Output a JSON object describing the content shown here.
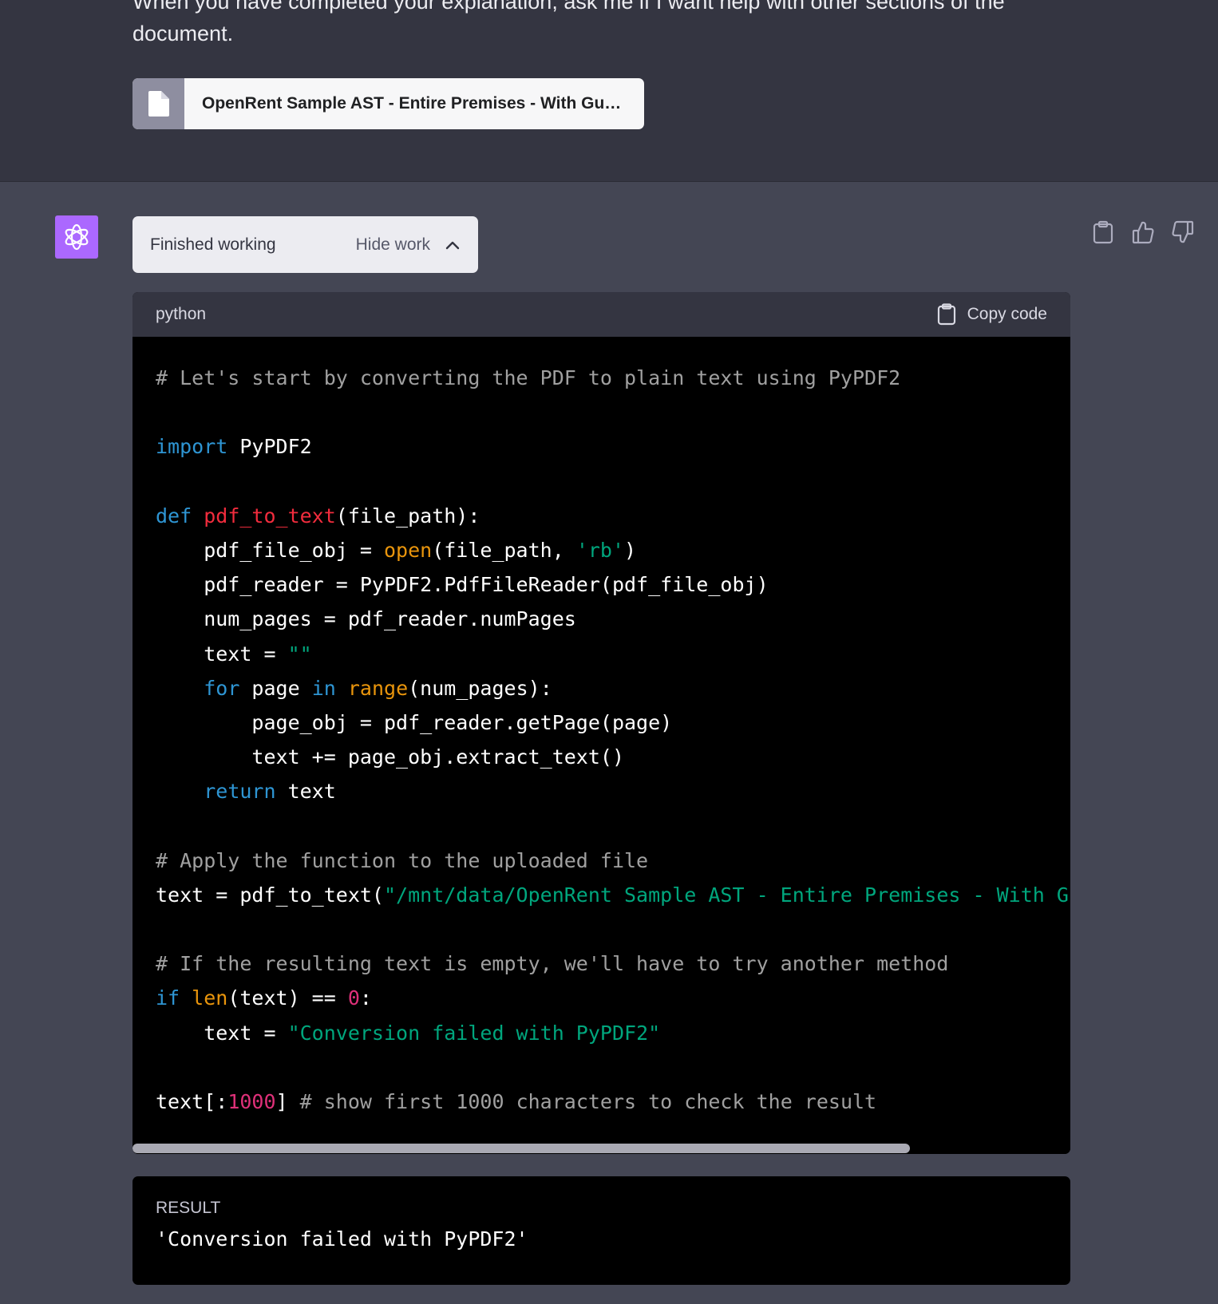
{
  "user_message": {
    "text": "When you have completed your explanation, ask me if I want help with other sections of the\ndocument.",
    "attachment": {
      "icon": "file-icon",
      "name": "OpenRent Sample AST - Entire Premises - With Guara..."
    }
  },
  "assistant": {
    "avatar_icon": "openai-logo-icon",
    "avatar_color": "#ab68ff",
    "work_status": "Finished working",
    "hide_work_label": "Hide work",
    "actions": [
      "copy-icon",
      "thumbs-up-icon",
      "thumbs-down-icon"
    ],
    "code_block": {
      "language": "python",
      "copy_label": "Copy code",
      "lines": [
        [
          [
            "c",
            "# Let's start by converting the PDF to plain text using PyPDF2"
          ]
        ],
        [],
        [
          [
            "k",
            "import"
          ],
          [
            "",
            " PyPDF2"
          ]
        ],
        [],
        [
          [
            "k",
            "def"
          ],
          [
            "",
            " "
          ],
          [
            "f",
            "pdf_to_text"
          ],
          [
            "",
            "(file_path):"
          ]
        ],
        [
          [
            "",
            "    pdf_file_obj = "
          ],
          [
            "b",
            "open"
          ],
          [
            "",
            "(file_path, "
          ],
          [
            "s",
            "'rb'"
          ],
          [
            "",
            ")"
          ]
        ],
        [
          [
            "",
            "    pdf_reader = PyPDF2.PdfFileReader(pdf_file_obj)"
          ]
        ],
        [
          [
            "",
            "    num_pages = pdf_reader.numPages"
          ]
        ],
        [
          [
            "",
            "    text = "
          ],
          [
            "s",
            "\"\""
          ]
        ],
        [
          [
            "",
            "    "
          ],
          [
            "k",
            "for"
          ],
          [
            "",
            " page "
          ],
          [
            "k",
            "in"
          ],
          [
            "",
            " "
          ],
          [
            "b",
            "range"
          ],
          [
            "",
            "(num_pages):"
          ]
        ],
        [
          [
            "",
            "        page_obj = pdf_reader.getPage(page)"
          ]
        ],
        [
          [
            "",
            "        text += page_obj.extract_text()"
          ]
        ],
        [
          [
            "",
            "    "
          ],
          [
            "k",
            "return"
          ],
          [
            "",
            " text"
          ]
        ],
        [],
        [
          [
            "c",
            "# Apply the function to the uploaded file"
          ]
        ],
        [
          [
            "",
            "text = pdf_to_text("
          ],
          [
            "s",
            "\"/mnt/data/OpenRent Sample AST - Entire Premises - With G"
          ]
        ],
        [],
        [
          [
            "c",
            "# If the resulting text is empty, we'll have to try another method"
          ]
        ],
        [
          [
            "k",
            "if"
          ],
          [
            "",
            " "
          ],
          [
            "b",
            "len"
          ],
          [
            "",
            "(text) == "
          ],
          [
            "n",
            "0"
          ],
          [
            "",
            ":"
          ]
        ],
        [
          [
            "",
            "    text = "
          ],
          [
            "s",
            "\"Conversion failed with PyPDF2\""
          ]
        ],
        [],
        [
          [
            "",
            "text[:"
          ],
          [
            "n",
            "1000"
          ],
          [
            "",
            "] "
          ],
          [
            "c",
            "# show first 1000 characters to check the result"
          ]
        ]
      ]
    },
    "result": {
      "label": "RESULT",
      "value": "'Conversion failed with PyPDF2'"
    }
  }
}
